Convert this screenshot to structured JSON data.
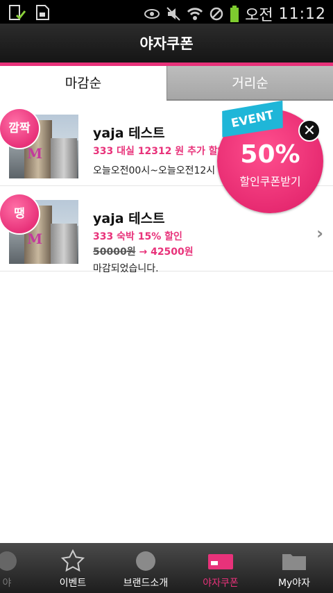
{
  "statusbar": {
    "time": "11:12",
    "ampm": "오전",
    "icons": [
      "storage-icon",
      "sdcard-icon",
      "eye-icon",
      "mute-icon",
      "wifi-icon",
      "block-icon",
      "battery-icon"
    ]
  },
  "header": {
    "title": "야자쿠폰"
  },
  "tabs": [
    {
      "label": "마감순",
      "active": true
    },
    {
      "label": "거리순",
      "active": false
    }
  ],
  "list": [
    {
      "badge": "깜짝",
      "title": "yaja 테스트",
      "promo": "333 대실 12312 원 추가 할인",
      "time": "오늘오전00시~오늘오전12시"
    },
    {
      "badge": "땡",
      "title": "yaja 테스트",
      "promo": "333 숙박 15% 할인",
      "price_original": "50000원",
      "price_arrow": "→",
      "price_new": "42500원",
      "status": "마감되었습니다."
    }
  ],
  "event_popup": {
    "ribbon": "EVENT",
    "percent": "50%",
    "subtitle": "할인쿠폰받기",
    "close": "✕"
  },
  "bottom_nav": [
    {
      "label": "야",
      "icon": "circle-icon"
    },
    {
      "label": "이벤트",
      "icon": "star-icon"
    },
    {
      "label": "브랜드소개",
      "icon": "search-icon"
    },
    {
      "label": "야자쿠폰",
      "icon": "coupon-icon",
      "active": true
    },
    {
      "label": "My야자",
      "icon": "folder-icon"
    }
  ],
  "colors": {
    "accent": "#e8327a",
    "event_blue": "#1fb6d8"
  }
}
